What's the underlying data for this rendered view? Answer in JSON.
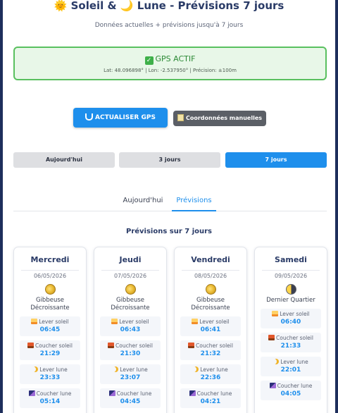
{
  "header": {
    "sun_emoji": "🌞",
    "moon_emoji": "🌙",
    "title_part1": "Soleil &",
    "title_part2": "Lune - Prévisions 7 jours",
    "subtitle": "Données actuelles + prévisions jusqu'à 7 jours"
  },
  "gps": {
    "status": "GPS ACTIF",
    "check_glyph": "✓",
    "coords": "Lat: 48.096898° | Lon: -2.537950° | Précision: ±100m"
  },
  "actions": {
    "refresh_label": "ACTUALISER GPS",
    "manual_label": "Coordonnées manuelles"
  },
  "ranges": [
    {
      "label": "Aujourd'hui",
      "active": false
    },
    {
      "label": "3 jours",
      "active": false
    },
    {
      "label": "7 jours",
      "active": true
    }
  ],
  "tabs": [
    {
      "label": "Aujourd'hui",
      "active": false
    },
    {
      "label": "Prévisions",
      "active": true
    }
  ],
  "forecast": {
    "title": "Prévisions sur 7 jours",
    "labels": {
      "sunrise": "Lever soleil",
      "sunset": "Coucher soleil",
      "moonrise": "Lever lune",
      "moonset": "Coucher lune"
    },
    "days": [
      {
        "day": "Mercredi",
        "date": "06/05/2026",
        "phase_line1": "Gibbeuse",
        "phase_line2": "Décroissante",
        "sunrise": "06:45",
        "sunset": "21:29",
        "moonrise": "23:33",
        "moonset": "05:14"
      },
      {
        "day": "Jeudi",
        "date": "07/05/2026",
        "phase_line1": "Gibbeuse",
        "phase_line2": "Décroissante",
        "sunrise": "06:43",
        "sunset": "21:30",
        "moonrise": "23:07",
        "moonset": "04:45"
      },
      {
        "day": "Vendredi",
        "date": "08/05/2026",
        "phase_line1": "Gibbeuse",
        "phase_line2": "Décroissante",
        "sunrise": "06:41",
        "sunset": "21:32",
        "moonrise": "22:36",
        "moonset": "04:21"
      },
      {
        "day": "Samedi",
        "date": "09/05/2026",
        "phase_line1": "Dernier Quartier",
        "phase_line2": "",
        "sunrise": "06:40",
        "sunset": "21:33",
        "moonrise": "22:01",
        "moonset": "04:05"
      }
    ]
  }
}
